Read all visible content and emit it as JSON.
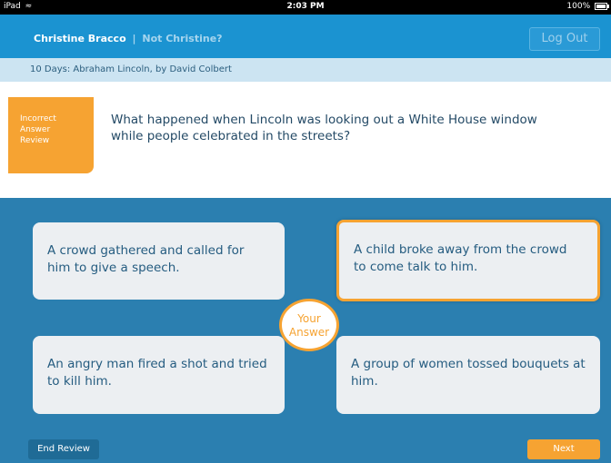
{
  "status_bar": {
    "device": "iPad",
    "time": "2:03 PM",
    "battery": "100%"
  },
  "header": {
    "user_name": "Christine Bracco",
    "separator": "|",
    "not_user_link": "Not Christine?",
    "logout_label": "Log Out"
  },
  "book": {
    "title": "10 Days: Abraham Lincoln, by David Colbert"
  },
  "question": {
    "tag_lines": [
      "Incorrect",
      "Answer",
      "Review"
    ],
    "text": "What happened when Lincoln was looking out a White House window while people celebrated in the streets?"
  },
  "answers": [
    {
      "text": "A crowd gathered and called for him to give a speech."
    },
    {
      "text": "A child broke away from the crowd to come talk to him."
    },
    {
      "text": "An angry man fired a shot and tried to kill him."
    },
    {
      "text": "A group of women tossed bouquets at him."
    }
  ],
  "your_answer_label_lines": [
    "Your",
    "Answer"
  ],
  "footer": {
    "end_review_label": "End Review",
    "next_label": "Next"
  },
  "colors": {
    "primary_blue": "#1b93d1",
    "accent_orange": "#f6a332",
    "background_blue": "#2b7fb0"
  }
}
